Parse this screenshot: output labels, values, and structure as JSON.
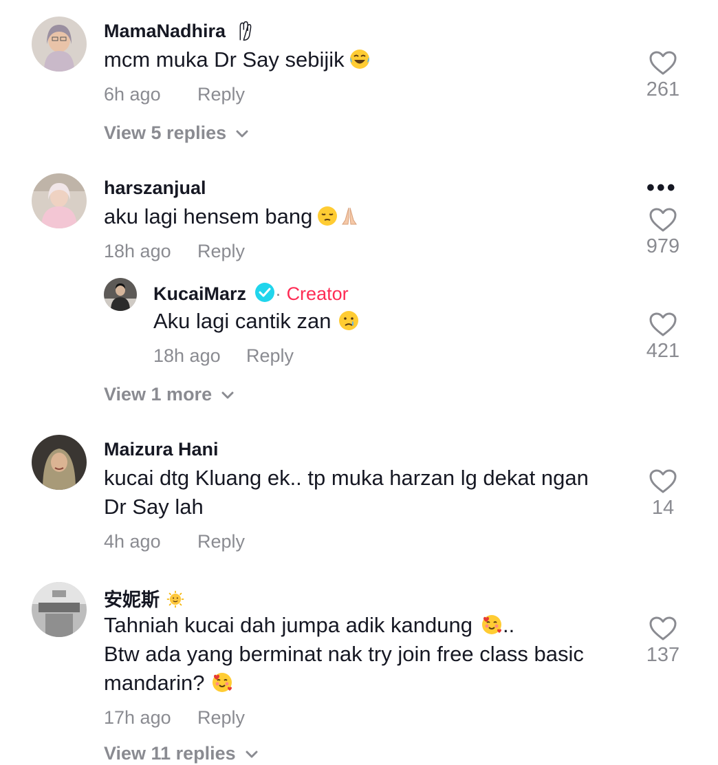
{
  "comments": [
    {
      "username": "MamaNadhira",
      "username_badge": "palm-tree-icon",
      "text": "mcm muka Dr Say sebijik",
      "emoji": "tears-of-joy-emoji",
      "time": "6h ago",
      "reply_label": "Reply",
      "likes": "261",
      "view_replies": "View 5 replies"
    },
    {
      "username": "harszanjual",
      "text": "aku lagi hensem bang",
      "emoji": "pensive-folded-hands-emoji",
      "time": "18h ago",
      "reply_label": "Reply",
      "likes": "979",
      "more_menu": "•••",
      "reply": {
        "username": "KucaiMarz",
        "separator": "·",
        "creator_label": "Creator",
        "text": "Aku lagi cantik zan",
        "emoji": "crying-face-emoji",
        "time": "18h ago",
        "reply_label": "Reply",
        "likes": "421"
      },
      "view_replies": "View 1 more"
    },
    {
      "username": "Maizura Hani",
      "text_line1": "kucai dtg Kluang ek.. tp muka harzan lg dekat ngan",
      "text_line2": "Dr Say lah",
      "time": "4h ago",
      "reply_label": "Reply",
      "likes": "14"
    },
    {
      "username": "安妮斯",
      "username_badge": "sun-face-emoji",
      "text_line1": "Tahniah kucai dah jumpa adik kandung",
      "text_line1_suffix": "..",
      "text_line2": "Btw ada yang berminat nak try join free class basic",
      "text_line3": "mandarin?",
      "emoji": "smiling-face-with-hearts-emoji",
      "time": "17h ago",
      "reply_label": "Reply",
      "likes": "137",
      "view_replies": "View 11 replies"
    }
  ],
  "colors": {
    "text": "#161823",
    "secondary": "#8a8b91",
    "creator": "#fe2c55",
    "verified": "#20d5ec"
  }
}
